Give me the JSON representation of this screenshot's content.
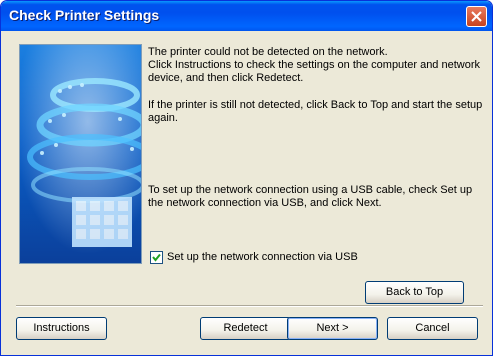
{
  "window": {
    "title": "Check Printer Settings"
  },
  "message": {
    "p1_line1": "The printer could not be detected on the network.",
    "p1_rest": "Click Instructions to check the settings on the computer and network device, and then click Redetect.",
    "p2": "If the printer is still not detected, click Back to Top and start the setup again.",
    "p3": "To set up the network connection using a USB cable, check Set up the network connection via USB, and click Next."
  },
  "usb_option": {
    "label": "Set up the network connection via USB",
    "checked": true
  },
  "buttons": {
    "back_to_top": "Back to Top",
    "instructions": "Instructions",
    "redetect": "Redetect",
    "next": "Next >",
    "cancel": "Cancel"
  }
}
